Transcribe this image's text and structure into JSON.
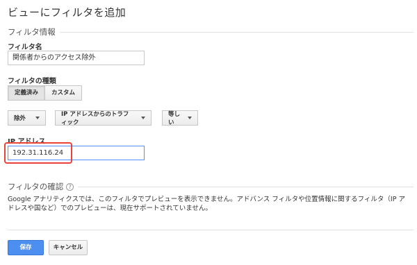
{
  "page": {
    "title": "ビューにフィルタを追加"
  },
  "filter_info": {
    "section_label": "フィルタ情報",
    "name_label": "フィルタ名",
    "name_value": "関係者からのアクセス除外",
    "type_label": "フィルタの種類",
    "type_tabs": [
      "定義済み",
      "カスタム"
    ],
    "type_selected": "定義済み",
    "dropdowns": {
      "action": "除外",
      "source": "IP アドレスからのトラフィック",
      "expression": "等しい"
    },
    "ip_label": "IP アドレス",
    "ip_value": "192.31.116.24"
  },
  "verify": {
    "section_label": "フィルタの確認",
    "help_icon": "?",
    "note": "Google アナリティクスでは、このフィルタでプレビューを表示できません。アドバンス フィルタや位置情報に関するフィルタ（IP アドレスや国など）でのプレビューは、現在サポートされていません。"
  },
  "actions": {
    "save": "保存",
    "cancel": "キャンセル"
  },
  "colors": {
    "primary": "#4d8ff0",
    "highlight": "#e8423b",
    "focus_border": "#4d90fe"
  }
}
